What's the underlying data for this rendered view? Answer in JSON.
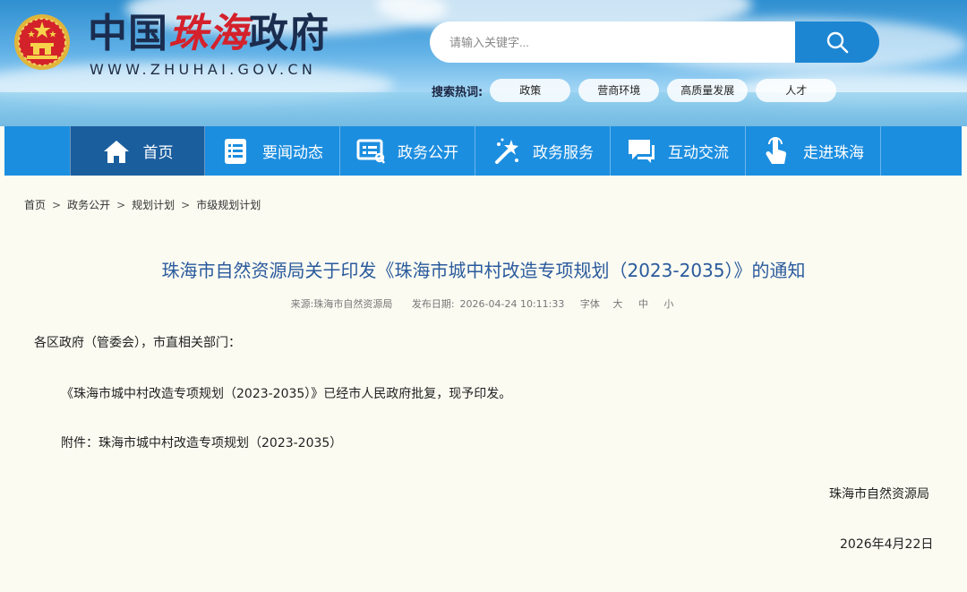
{
  "header": {
    "title_parts": [
      "中国",
      "珠海",
      "政府"
    ],
    "url": "WWW.ZHUHAI.GOV.CN",
    "search_placeholder": "请输入关键字...",
    "hot_label": "搜索热词:",
    "hot_tags": [
      "政策",
      "营商环境",
      "高质量发展",
      "人才"
    ]
  },
  "nav": {
    "items": [
      {
        "label": "首页",
        "icon": "home-icon"
      },
      {
        "label": "要闻动态",
        "icon": "news-list-icon"
      },
      {
        "label": "政务公开",
        "icon": "public-doc-icon"
      },
      {
        "label": "政务服务",
        "icon": "service-wand-icon"
      },
      {
        "label": "互动交流",
        "icon": "chat-icon"
      },
      {
        "label": "走进珠海",
        "icon": "tap-hand-icon"
      }
    ]
  },
  "breadcrumb": [
    "首页",
    "政务公开",
    "规划计划",
    "市级规划计划"
  ],
  "article": {
    "title": "珠海市自然资源局关于印发《珠海市城中村改造专项规划（2023-2035）》的通知",
    "source_label": "来源:",
    "source": "珠海市自然资源局",
    "date_label": "发布日期:",
    "date": "2026-04-24 10:11:33",
    "font_label": "字体",
    "font_sizes": [
      "大",
      "中",
      "小"
    ],
    "salutation": "各区政府（管委会），市直相关部门：",
    "paragraph": "《珠海市城中村改造专项规划（2023-2035）》已经市人民政府批复，现予印发。",
    "attachment": "附件：珠海市城中村改造专项规划（2023-2035）",
    "signature": "珠海市自然资源局",
    "sign_date": "2026年4月22日"
  }
}
